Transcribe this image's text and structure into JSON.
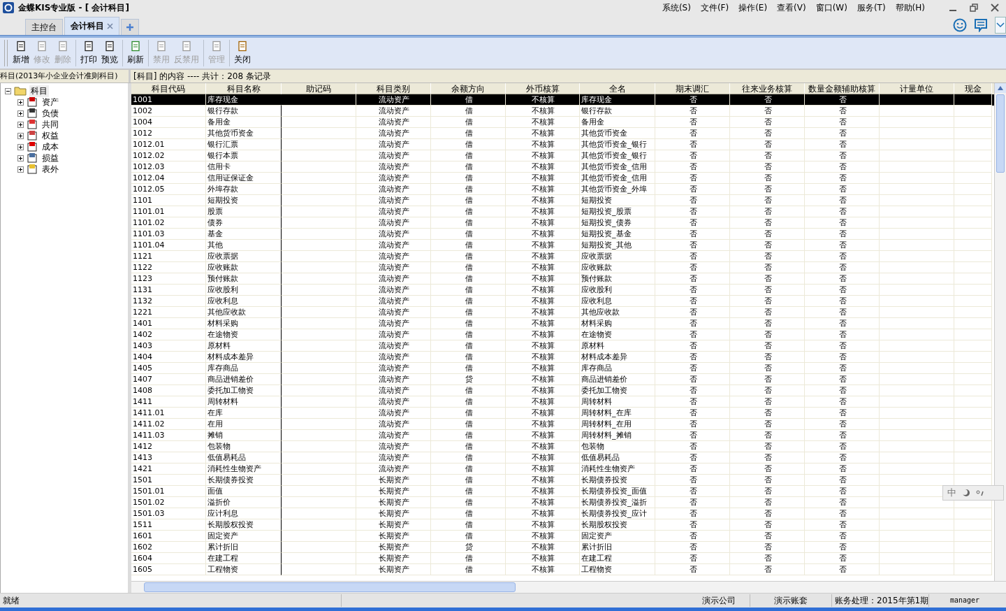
{
  "window": {
    "title": "金蝶KIS专业版 - [ 会计科目]"
  },
  "menu": [
    {
      "label": "系统(S)"
    },
    {
      "label": "文件(F)"
    },
    {
      "label": "操作(E)"
    },
    {
      "label": "查看(V)"
    },
    {
      "label": "窗口(W)"
    },
    {
      "label": "服务(T)"
    },
    {
      "label": "帮助(H)"
    }
  ],
  "tabs": [
    {
      "label": "主控台",
      "selected": false,
      "closable": false
    },
    {
      "label": "会计科目",
      "selected": true,
      "closable": true
    }
  ],
  "toolbar": [
    {
      "buttons": [
        {
          "label": "新增",
          "disabled": false
        },
        {
          "label": "修改",
          "disabled": true
        },
        {
          "label": "删除",
          "disabled": true
        }
      ]
    },
    {
      "buttons": [
        {
          "label": "打印",
          "disabled": false
        },
        {
          "label": "预览",
          "disabled": false
        }
      ]
    },
    {
      "buttons": [
        {
          "label": "刷新",
          "disabled": false
        }
      ]
    },
    {
      "buttons": [
        {
          "label": "禁用",
          "disabled": true
        },
        {
          "label": "反禁用",
          "disabled": true
        }
      ]
    },
    {
      "buttons": [
        {
          "label": "管理",
          "disabled": true
        }
      ]
    },
    {
      "buttons": [
        {
          "label": "关闭",
          "disabled": false
        }
      ]
    }
  ],
  "tree": {
    "title": "科目(2013年小企业会计准则科目)",
    "root": {
      "label": "科目",
      "expanded": true,
      "selected": true,
      "children": [
        {
          "label": "资产",
          "expanded": false,
          "selected": false
        },
        {
          "label": "负债",
          "expanded": false,
          "selected": false
        },
        {
          "label": "共同",
          "expanded": false,
          "selected": false
        },
        {
          "label": "权益",
          "expanded": false,
          "selected": false
        },
        {
          "label": "成本",
          "expanded": false,
          "selected": false
        },
        {
          "label": "损益",
          "expanded": false,
          "selected": false
        },
        {
          "label": "表外",
          "expanded": false,
          "selected": false
        }
      ]
    }
  },
  "table": {
    "caption": "[科目] 的内容 ---- 共计：208 条记录",
    "columns": [
      "科目代码",
      "科目名称",
      "助记码",
      "科目类别",
      "余额方向",
      "外币核算",
      "全名",
      "期末调汇",
      "往来业务核算",
      "数量金额辅助核算",
      "计量单位",
      "现金"
    ],
    "rows": [
      {
        "selected": true,
        "code": "1001",
        "name": "库存现金",
        "category": "流动资产",
        "direction": "借",
        "foreign": "不核算",
        "full": "库存现金",
        "adjust": "否",
        "contact": "否",
        "quantity": "否"
      },
      {
        "selected": false,
        "code": "1002",
        "name": "银行存款",
        "category": "流动资产",
        "direction": "借",
        "foreign": "不核算",
        "full": "银行存款",
        "adjust": "否",
        "contact": "否",
        "quantity": "否"
      },
      {
        "selected": false,
        "code": "1004",
        "name": "备用金",
        "category": "流动资产",
        "direction": "借",
        "foreign": "不核算",
        "full": "备用金",
        "adjust": "否",
        "contact": "否",
        "quantity": "否"
      },
      {
        "selected": false,
        "code": "1012",
        "name": "其他货币资金",
        "category": "流动资产",
        "direction": "借",
        "foreign": "不核算",
        "full": "其他货币资金",
        "adjust": "否",
        "contact": "否",
        "quantity": "否"
      },
      {
        "selected": false,
        "code": "1012.01",
        "name": "银行汇票",
        "category": "流动资产",
        "direction": "借",
        "foreign": "不核算",
        "full": "其他货币资金_银行",
        "adjust": "否",
        "contact": "否",
        "quantity": "否"
      },
      {
        "selected": false,
        "code": "1012.02",
        "name": "银行本票",
        "category": "流动资产",
        "direction": "借",
        "foreign": "不核算",
        "full": "其他货币资金_银行",
        "adjust": "否",
        "contact": "否",
        "quantity": "否"
      },
      {
        "selected": false,
        "code": "1012.03",
        "name": "信用卡",
        "category": "流动资产",
        "direction": "借",
        "foreign": "不核算",
        "full": "其他货币资金_信用",
        "adjust": "否",
        "contact": "否",
        "quantity": "否"
      },
      {
        "selected": false,
        "code": "1012.04",
        "name": "信用证保证金",
        "category": "流动资产",
        "direction": "借",
        "foreign": "不核算",
        "full": "其他货币资金_信用",
        "adjust": "否",
        "contact": "否",
        "quantity": "否"
      },
      {
        "selected": false,
        "code": "1012.05",
        "name": "外埠存款",
        "category": "流动资产",
        "direction": "借",
        "foreign": "不核算",
        "full": "其他货币资金_外埠",
        "adjust": "否",
        "contact": "否",
        "quantity": "否"
      },
      {
        "selected": false,
        "code": "1101",
        "name": "短期投资",
        "category": "流动资产",
        "direction": "借",
        "foreign": "不核算",
        "full": "短期投资",
        "adjust": "否",
        "contact": "否",
        "quantity": "否"
      },
      {
        "selected": false,
        "code": "1101.01",
        "name": "股票",
        "category": "流动资产",
        "direction": "借",
        "foreign": "不核算",
        "full": "短期投资_股票",
        "adjust": "否",
        "contact": "否",
        "quantity": "否"
      },
      {
        "selected": false,
        "code": "1101.02",
        "name": "债券",
        "category": "流动资产",
        "direction": "借",
        "foreign": "不核算",
        "full": "短期投资_债券",
        "adjust": "否",
        "contact": "否",
        "quantity": "否"
      },
      {
        "selected": false,
        "code": "1101.03",
        "name": "基金",
        "category": "流动资产",
        "direction": "借",
        "foreign": "不核算",
        "full": "短期投资_基金",
        "adjust": "否",
        "contact": "否",
        "quantity": "否"
      },
      {
        "selected": false,
        "code": "1101.04",
        "name": "其他",
        "category": "流动资产",
        "direction": "借",
        "foreign": "不核算",
        "full": "短期投资_其他",
        "adjust": "否",
        "contact": "否",
        "quantity": "否"
      },
      {
        "selected": false,
        "code": "1121",
        "name": "应收票据",
        "category": "流动资产",
        "direction": "借",
        "foreign": "不核算",
        "full": "应收票据",
        "adjust": "否",
        "contact": "否",
        "quantity": "否"
      },
      {
        "selected": false,
        "code": "1122",
        "name": "应收账款",
        "category": "流动资产",
        "direction": "借",
        "foreign": "不核算",
        "full": "应收账款",
        "adjust": "否",
        "contact": "否",
        "quantity": "否"
      },
      {
        "selected": false,
        "code": "1123",
        "name": "预付账款",
        "category": "流动资产",
        "direction": "借",
        "foreign": "不核算",
        "full": "预付账款",
        "adjust": "否",
        "contact": "否",
        "quantity": "否"
      },
      {
        "selected": false,
        "code": "1131",
        "name": "应收股利",
        "category": "流动资产",
        "direction": "借",
        "foreign": "不核算",
        "full": "应收股利",
        "adjust": "否",
        "contact": "否",
        "quantity": "否"
      },
      {
        "selected": false,
        "code": "1132",
        "name": "应收利息",
        "category": "流动资产",
        "direction": "借",
        "foreign": "不核算",
        "full": "应收利息",
        "adjust": "否",
        "contact": "否",
        "quantity": "否"
      },
      {
        "selected": false,
        "code": "1221",
        "name": "其他应收款",
        "category": "流动资产",
        "direction": "借",
        "foreign": "不核算",
        "full": "其他应收款",
        "adjust": "否",
        "contact": "否",
        "quantity": "否"
      },
      {
        "selected": false,
        "code": "1401",
        "name": "材料采购",
        "category": "流动资产",
        "direction": "借",
        "foreign": "不核算",
        "full": "材料采购",
        "adjust": "否",
        "contact": "否",
        "quantity": "否"
      },
      {
        "selected": false,
        "code": "1402",
        "name": "在途物资",
        "category": "流动资产",
        "direction": "借",
        "foreign": "不核算",
        "full": "在途物资",
        "adjust": "否",
        "contact": "否",
        "quantity": "否"
      },
      {
        "selected": false,
        "code": "1403",
        "name": "原材料",
        "category": "流动资产",
        "direction": "借",
        "foreign": "不核算",
        "full": "原材料",
        "adjust": "否",
        "contact": "否",
        "quantity": "否"
      },
      {
        "selected": false,
        "code": "1404",
        "name": "材料成本差异",
        "category": "流动资产",
        "direction": "借",
        "foreign": "不核算",
        "full": "材料成本差异",
        "adjust": "否",
        "contact": "否",
        "quantity": "否"
      },
      {
        "selected": false,
        "code": "1405",
        "name": "库存商品",
        "category": "流动资产",
        "direction": "借",
        "foreign": "不核算",
        "full": "库存商品",
        "adjust": "否",
        "contact": "否",
        "quantity": "否"
      },
      {
        "selected": false,
        "code": "1407",
        "name": "商品进销差价",
        "category": "流动资产",
        "direction": "贷",
        "foreign": "不核算",
        "full": "商品进销差价",
        "adjust": "否",
        "contact": "否",
        "quantity": "否"
      },
      {
        "selected": false,
        "code": "1408",
        "name": "委托加工物资",
        "category": "流动资产",
        "direction": "借",
        "foreign": "不核算",
        "full": "委托加工物资",
        "adjust": "否",
        "contact": "否",
        "quantity": "否"
      },
      {
        "selected": false,
        "code": "1411",
        "name": "周转材料",
        "category": "流动资产",
        "direction": "借",
        "foreign": "不核算",
        "full": "周转材料",
        "adjust": "否",
        "contact": "否",
        "quantity": "否"
      },
      {
        "selected": false,
        "code": "1411.01",
        "name": "在库",
        "category": "流动资产",
        "direction": "借",
        "foreign": "不核算",
        "full": "周转材料_在库",
        "adjust": "否",
        "contact": "否",
        "quantity": "否"
      },
      {
        "selected": false,
        "code": "1411.02",
        "name": "在用",
        "category": "流动资产",
        "direction": "借",
        "foreign": "不核算",
        "full": "周转材料_在用",
        "adjust": "否",
        "contact": "否",
        "quantity": "否"
      },
      {
        "selected": false,
        "code": "1411.03",
        "name": "摊销",
        "category": "流动资产",
        "direction": "借",
        "foreign": "不核算",
        "full": "周转材料_摊销",
        "adjust": "否",
        "contact": "否",
        "quantity": "否"
      },
      {
        "selected": false,
        "code": "1412",
        "name": "包装物",
        "category": "流动资产",
        "direction": "借",
        "foreign": "不核算",
        "full": "包装物",
        "adjust": "否",
        "contact": "否",
        "quantity": "否"
      },
      {
        "selected": false,
        "code": "1413",
        "name": "低值易耗品",
        "category": "流动资产",
        "direction": "借",
        "foreign": "不核算",
        "full": "低值易耗品",
        "adjust": "否",
        "contact": "否",
        "quantity": "否"
      },
      {
        "selected": false,
        "code": "1421",
        "name": "消耗性生物资产",
        "category": "流动资产",
        "direction": "借",
        "foreign": "不核算",
        "full": "消耗性生物资产",
        "adjust": "否",
        "contact": "否",
        "quantity": "否"
      },
      {
        "selected": false,
        "code": "1501",
        "name": "长期债券投资",
        "category": "长期资产",
        "direction": "借",
        "foreign": "不核算",
        "full": "长期债券投资",
        "adjust": "否",
        "contact": "否",
        "quantity": "否"
      },
      {
        "selected": false,
        "code": "1501.01",
        "name": "面值",
        "category": "长期资产",
        "direction": "借",
        "foreign": "不核算",
        "full": "长期债券投资_面值",
        "adjust": "否",
        "contact": "否",
        "quantity": "否"
      },
      {
        "selected": false,
        "code": "1501.02",
        "name": "溢折价",
        "category": "长期资产",
        "direction": "借",
        "foreign": "不核算",
        "full": "长期债券投资_溢折",
        "adjust": "否",
        "contact": "否",
        "quantity": "否"
      },
      {
        "selected": false,
        "code": "1501.03",
        "name": "应计利息",
        "category": "长期资产",
        "direction": "借",
        "foreign": "不核算",
        "full": "长期债券投资_应计",
        "adjust": "否",
        "contact": "否",
        "quantity": "否"
      },
      {
        "selected": false,
        "code": "1511",
        "name": "长期股权投资",
        "category": "长期资产",
        "direction": "借",
        "foreign": "不核算",
        "full": "长期股权投资",
        "adjust": "否",
        "contact": "否",
        "quantity": "否"
      },
      {
        "selected": false,
        "code": "1601",
        "name": "固定资产",
        "category": "长期资产",
        "direction": "借",
        "foreign": "不核算",
        "full": "固定资产",
        "adjust": "否",
        "contact": "否",
        "quantity": "否"
      },
      {
        "selected": false,
        "code": "1602",
        "name": "累计折旧",
        "category": "长期资产",
        "direction": "贷",
        "foreign": "不核算",
        "full": "累计折旧",
        "adjust": "否",
        "contact": "否",
        "quantity": "否"
      },
      {
        "selected": false,
        "code": "1604",
        "name": "在建工程",
        "category": "长期资产",
        "direction": "借",
        "foreign": "不核算",
        "full": "在建工程",
        "adjust": "否",
        "contact": "否",
        "quantity": "否"
      },
      {
        "selected": false,
        "code": "1605",
        "name": "工程物资",
        "category": "长期资产",
        "direction": "借",
        "foreign": "不核算",
        "full": "工程物资",
        "adjust": "否",
        "contact": "否",
        "quantity": "否"
      }
    ]
  },
  "ime_bar": {
    "label": "中"
  },
  "status_bar": [
    "就绪",
    "演示公司",
    "演示账套",
    "账务处理：2015年第1期",
    "manager"
  ]
}
